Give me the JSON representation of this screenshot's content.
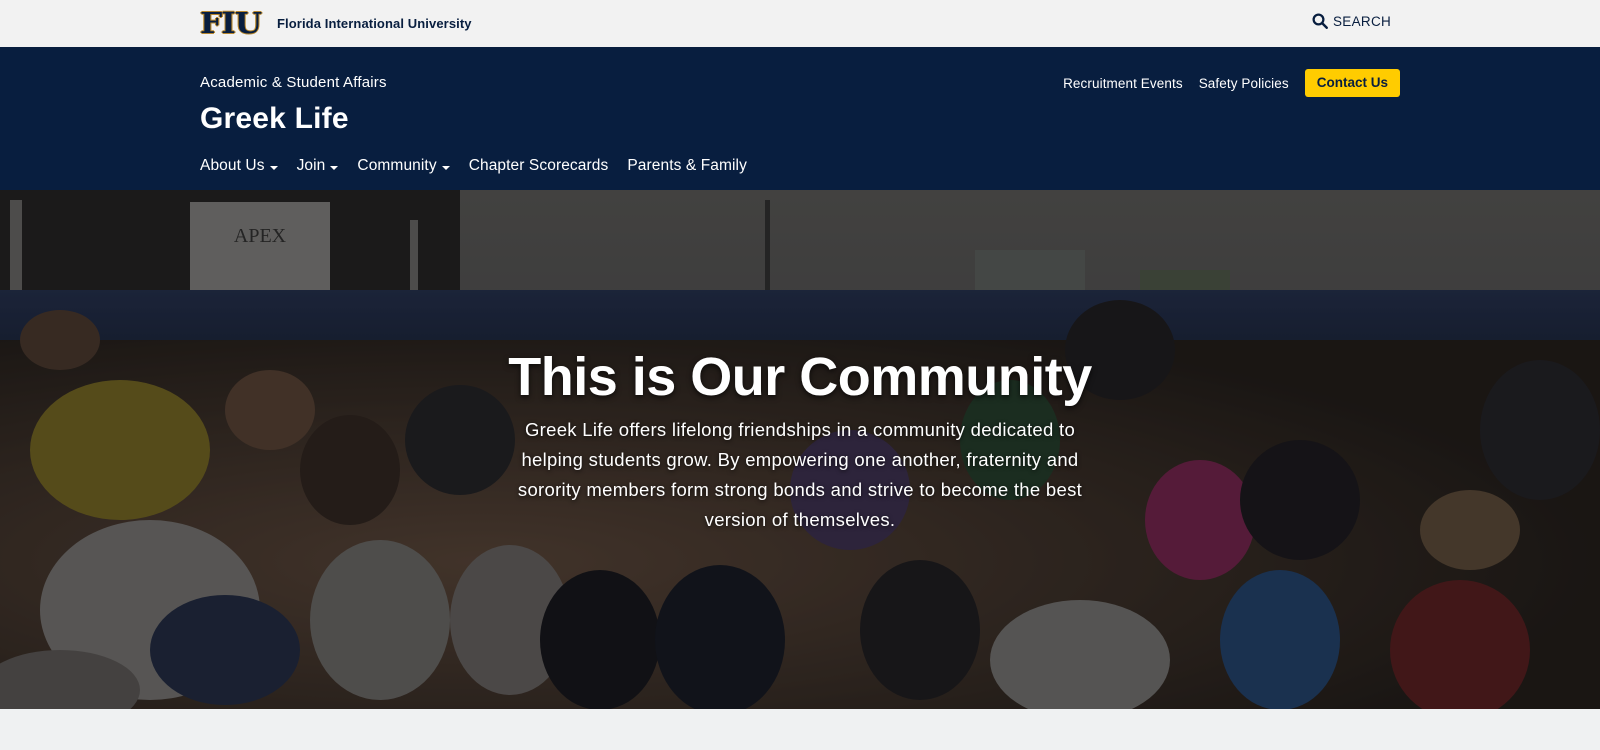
{
  "utility_bar": {
    "logo_text": "FIU",
    "university_name": "Florida International University",
    "search_label": "SEARCH",
    "icons": {
      "search": "search-icon"
    }
  },
  "header": {
    "parent_unit": "Academic & Student Affairs",
    "site_title": "Greek Life",
    "utility_links": [
      {
        "label": "Recruitment Events"
      },
      {
        "label": "Safety Policies"
      }
    ],
    "contact_button": "Contact Us",
    "nav": [
      {
        "label": "About Us",
        "has_dropdown": true
      },
      {
        "label": "Join",
        "has_dropdown": true
      },
      {
        "label": "Community",
        "has_dropdown": true
      },
      {
        "label": "Chapter Scorecards",
        "has_dropdown": false
      },
      {
        "label": "Parents & Family",
        "has_dropdown": false
      }
    ]
  },
  "hero": {
    "title": "This is Our Community",
    "text": "Greek Life offers lifelong friendships in a community dedicated to helping students grow. By empowering one another, fraternity and sorority members form strong bonds and strive to become the best version of themselves.",
    "image_description": "Crowd of FIU fraternity and sorority members cheering in a stadium"
  },
  "colors": {
    "navy": "#081e3f",
    "gold": "#ffcc00",
    "utility_bg": "#f2f2f2",
    "page_bg": "#eff1f2"
  }
}
